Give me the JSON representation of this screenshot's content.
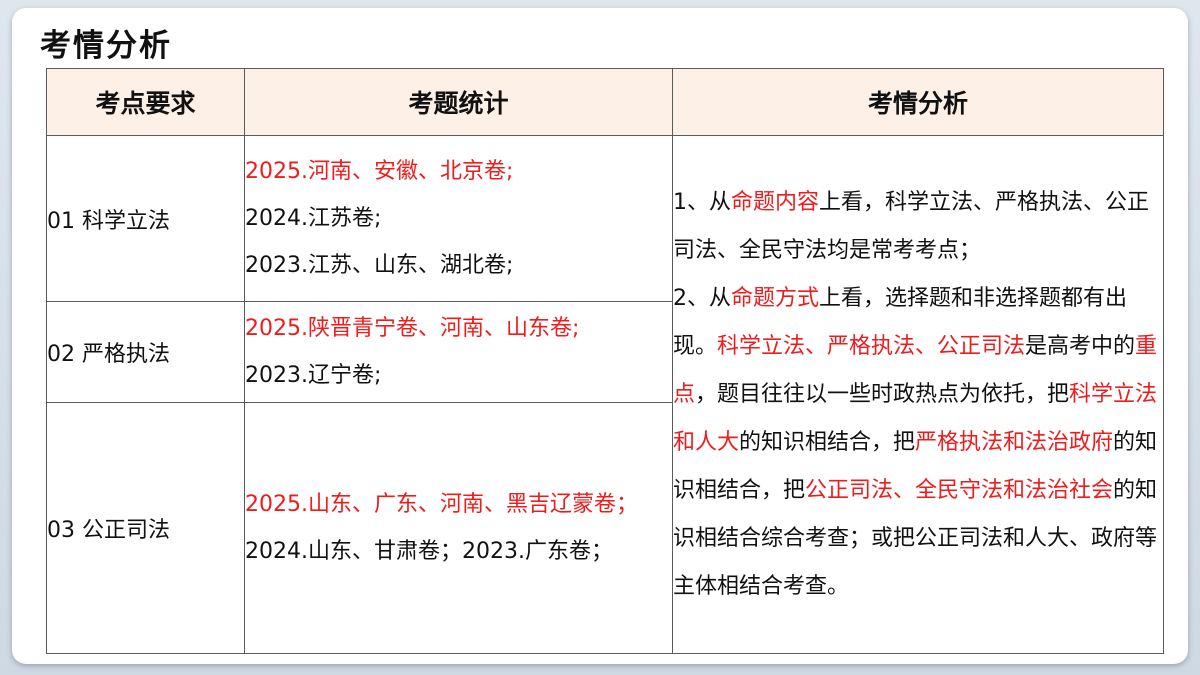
{
  "title": "考情分析",
  "headers": [
    "考点要求",
    "考题统计",
    "考情分析"
  ],
  "rows": [
    {
      "requirement": "01 科学立法",
      "stats": {
        "highlight": "2025.河南、安徽、北京卷;",
        "lines": [
          "2024.江苏卷;",
          "2023.江苏、山东、湖北卷;"
        ]
      }
    },
    {
      "requirement": "02 严格执法",
      "stats": {
        "highlight": "2025.陕晋青宁卷、河南、山东卷;",
        "lines": [
          "2023.辽宁卷;"
        ]
      }
    },
    {
      "requirement": "03 公正司法",
      "stats": {
        "highlight": "2025.山东、广东、河南、黑吉辽蒙卷；",
        "rest": "2024.山东、甘肃卷；2023.广东卷；"
      }
    }
  ],
  "analysis": {
    "p1_a": "1、从",
    "p1_b": "命题内容",
    "p1_c": "上看，科学立法、严格执法、公正司法、全民守法均是常考考点；",
    "p2_a": "2、从",
    "p2_b": "命题方式",
    "p2_c": "上看，选择题和非选择题都有出现。",
    "p2_d": "科学立法、严格执法、公正司法",
    "p2_e": "是高考中的",
    "p2_f": "重点",
    "p2_g": "，题目往往以一些时政热点为依托，把",
    "p2_h": "科学立法和人大",
    "p2_i": "的知识相结合，把",
    "p2_j": "严格执法和法治政府",
    "p2_k": "的知识相结合，把",
    "p2_l": "公正司法、全民守法和法治社会",
    "p2_m": "的知识相结合综合考查；或把公正司法和人大、政府等主体相结合考查。"
  },
  "colors": {
    "accent_red": "#ee1c1c",
    "header_bg": "#fdf0e6"
  }
}
